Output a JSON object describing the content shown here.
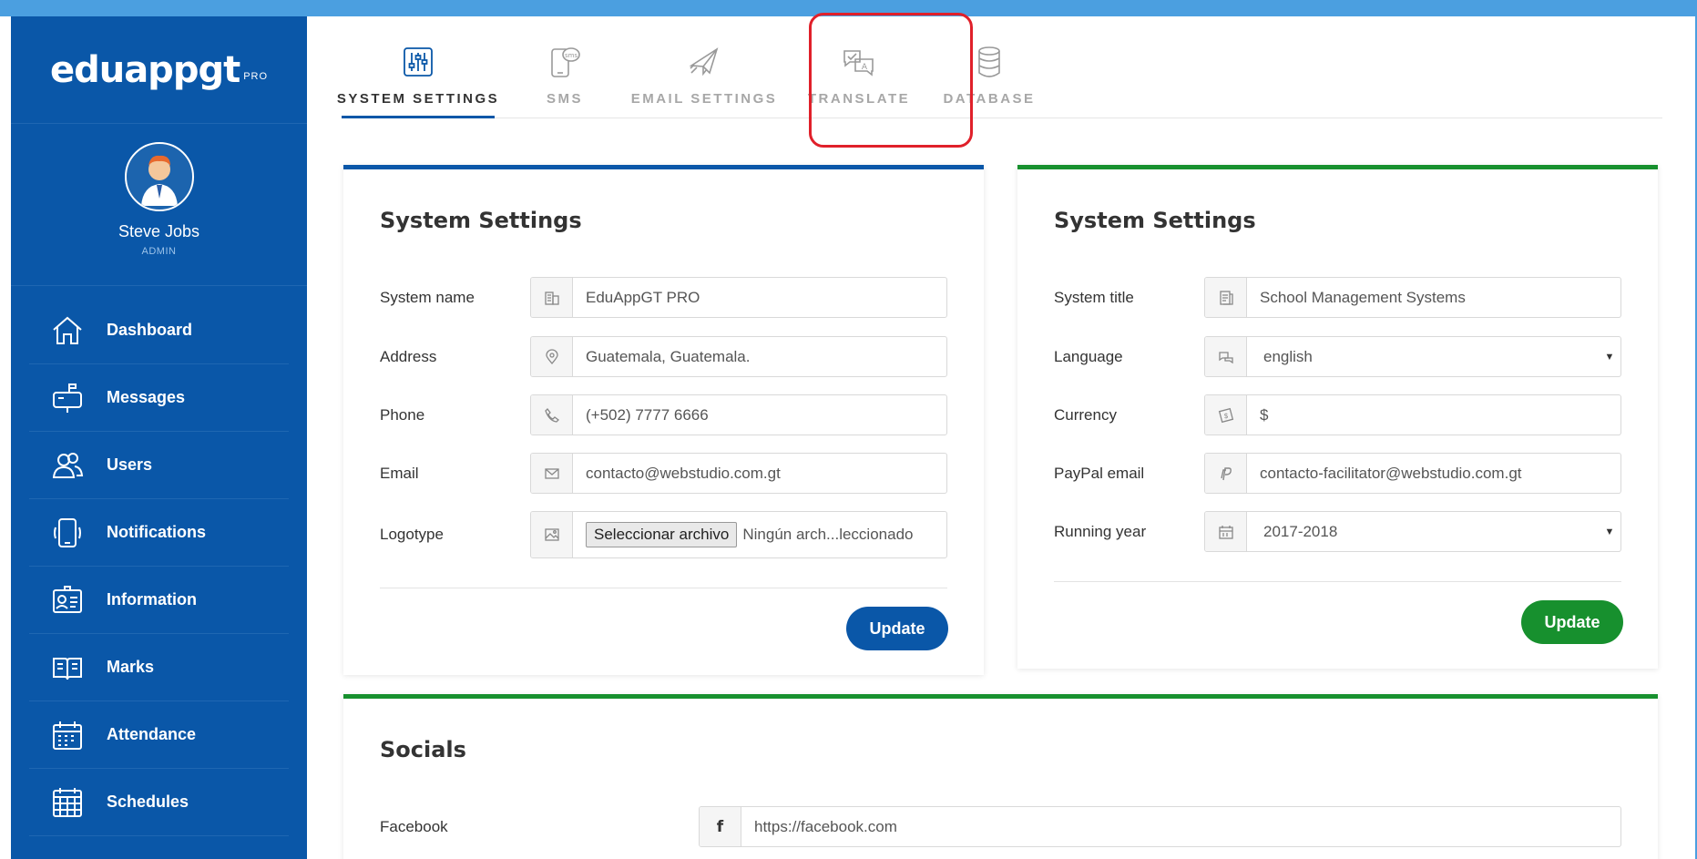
{
  "brand": {
    "name": "eduappgt",
    "suffix": "PRO"
  },
  "user": {
    "name": "Steve Jobs",
    "role": "ADMIN"
  },
  "sidebar": {
    "items": [
      {
        "label": "Dashboard",
        "icon": "home-icon"
      },
      {
        "label": "Messages",
        "icon": "mailbox-icon"
      },
      {
        "label": "Users",
        "icon": "users-icon"
      },
      {
        "label": "Notifications",
        "icon": "phone-notification-icon"
      },
      {
        "label": "Information",
        "icon": "id-card-icon"
      },
      {
        "label": "Marks",
        "icon": "book-icon"
      },
      {
        "label": "Attendance",
        "icon": "calendar-icon"
      },
      {
        "label": "Schedules",
        "icon": "schedule-icon"
      }
    ]
  },
  "tabs": [
    {
      "label": "SYSTEM SETTINGS",
      "icon": "sliders-icon",
      "active": true
    },
    {
      "label": "SMS",
      "icon": "sms-phone-icon",
      "active": false
    },
    {
      "label": "EMAIL SETTINGS",
      "icon": "paper-plane-icon",
      "active": false
    },
    {
      "label": "TRANSLATE",
      "icon": "translate-chat-icon",
      "active": false
    },
    {
      "label": "DATABASE",
      "icon": "database-icon",
      "active": false
    }
  ],
  "system_card": {
    "title": "System Settings",
    "fields": {
      "system_name": {
        "label": "System name",
        "value": "EduAppGT PRO"
      },
      "address": {
        "label": "Address",
        "value": "Guatemala, Guatemala."
      },
      "phone": {
        "label": "Phone",
        "value": "(+502) 7777 6666"
      },
      "email": {
        "label": "Email",
        "value": "contacto@webstudio.com.gt"
      },
      "logotype": {
        "label": "Logotype",
        "button": "Seleccionar archivo",
        "status": "Ningún arch...leccionado"
      }
    },
    "button": "Update"
  },
  "site_card": {
    "title": "System Settings",
    "fields": {
      "system_title": {
        "label": "System title",
        "value": "School Management Systems"
      },
      "language": {
        "label": "Language",
        "value": "english"
      },
      "currency": {
        "label": "Currency",
        "value": "$"
      },
      "paypal": {
        "label": "PayPal email",
        "value": "contacto-facilitator@webstudio.com.gt"
      },
      "running_year": {
        "label": "Running year",
        "value": "2017-2018"
      }
    },
    "button": "Update"
  },
  "socials_card": {
    "title": "Socials",
    "facebook": {
      "label": "Facebook",
      "value": "https://facebook.com"
    }
  },
  "colors": {
    "primary": "#0a57a8",
    "success": "#17902e",
    "highlight": "#e0202a",
    "frame": "#4b9fe0"
  }
}
